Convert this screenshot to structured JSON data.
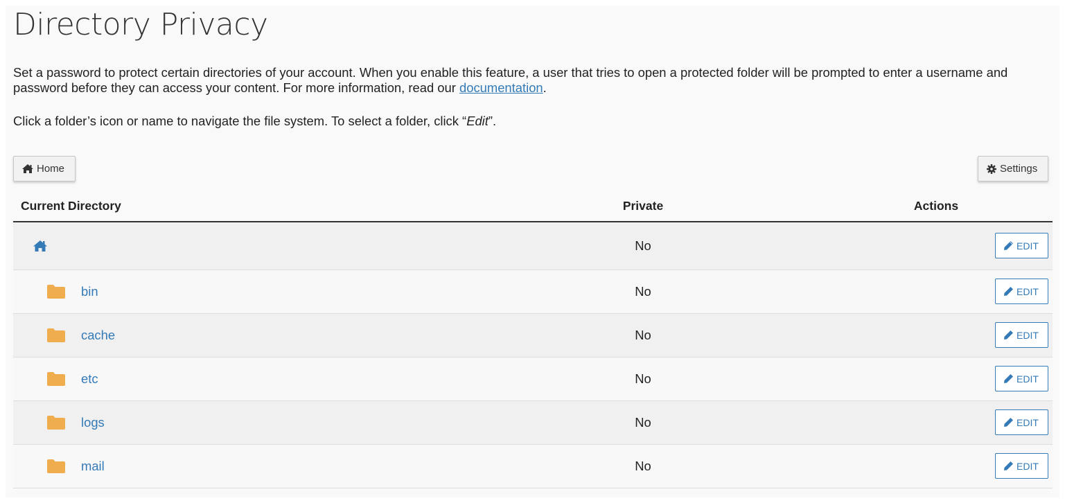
{
  "page": {
    "title": "Directory Privacy",
    "intro_text": "Set a password to protect certain directories of your account. When you enable this feature, a user that tries to open a protected folder will be prompted to enter a username and password before they can access your content. For more information, read our ",
    "intro_link": "documentation",
    "intro_end": ".",
    "hint_text": "Click a folder’s icon or name to navigate the file system. To select a folder, click “",
    "hint_em": "Edit",
    "hint_end": "”."
  },
  "toolbar": {
    "home_label": "Home",
    "settings_label": "Settings"
  },
  "table": {
    "headers": {
      "directory": "Current Directory",
      "private": "Private",
      "actions": "Actions"
    },
    "root": {
      "private": "No",
      "action": "EDIT"
    },
    "rows": [
      {
        "name": "bin",
        "private": "No",
        "action": "EDIT"
      },
      {
        "name": "cache",
        "private": "No",
        "action": "EDIT"
      },
      {
        "name": "etc",
        "private": "No",
        "action": "EDIT"
      },
      {
        "name": "logs",
        "private": "No",
        "action": "EDIT"
      },
      {
        "name": "mail",
        "private": "No",
        "action": "EDIT"
      }
    ]
  },
  "colors": {
    "link": "#337ab7",
    "folder": "#f0ad4e",
    "panel_bg": "#f9f9f9"
  },
  "icons": {
    "home_button": "home-icon",
    "settings_button": "gear-icon",
    "root_row": "home-icon",
    "folder_rows": "folder-icon",
    "edit_button": "pencil-icon"
  }
}
